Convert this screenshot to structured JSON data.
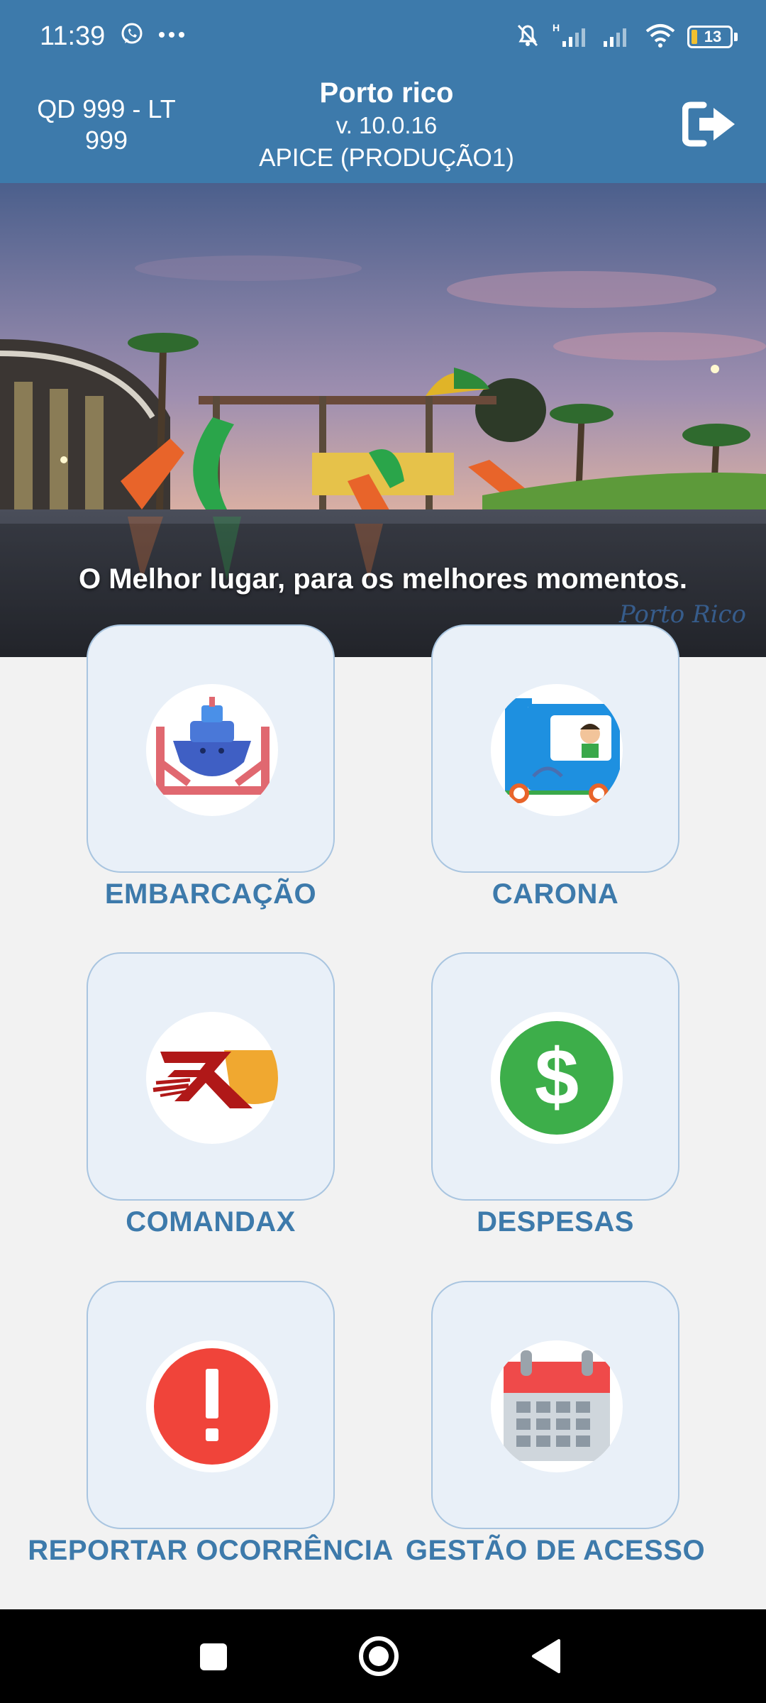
{
  "status_bar": {
    "time": "11:39",
    "battery_level": "13",
    "network_type": "H"
  },
  "header": {
    "unit": "QD 999 - LT 999",
    "title": "Porto rico",
    "version": "v. 10.0.16",
    "environment": "APICE (PRODUÇÃO1)"
  },
  "banner": {
    "caption": "O Melhor lugar, para os melhores momentos.",
    "logo_text": "Porto Rico"
  },
  "menu": {
    "items": [
      {
        "label": "EMBARCAÇÃO",
        "icon": "boat-icon"
      },
      {
        "label": "CARONA",
        "icon": "train-icon"
      },
      {
        "label": "COMANDAX",
        "icon": "comandax-logo-icon"
      },
      {
        "label": "DESPESAS",
        "icon": "dollar-icon"
      },
      {
        "label": "REPORTAR OCORRÊNCIA",
        "icon": "alert-icon"
      },
      {
        "label": "GESTÃO DE ACESSO",
        "icon": "calendar-icon"
      }
    ]
  },
  "colors": {
    "primary": "#3d7aab",
    "tile_background": "#e9f0f8",
    "tile_border": "#a9c5e0",
    "page_background": "#f2f2f2"
  }
}
